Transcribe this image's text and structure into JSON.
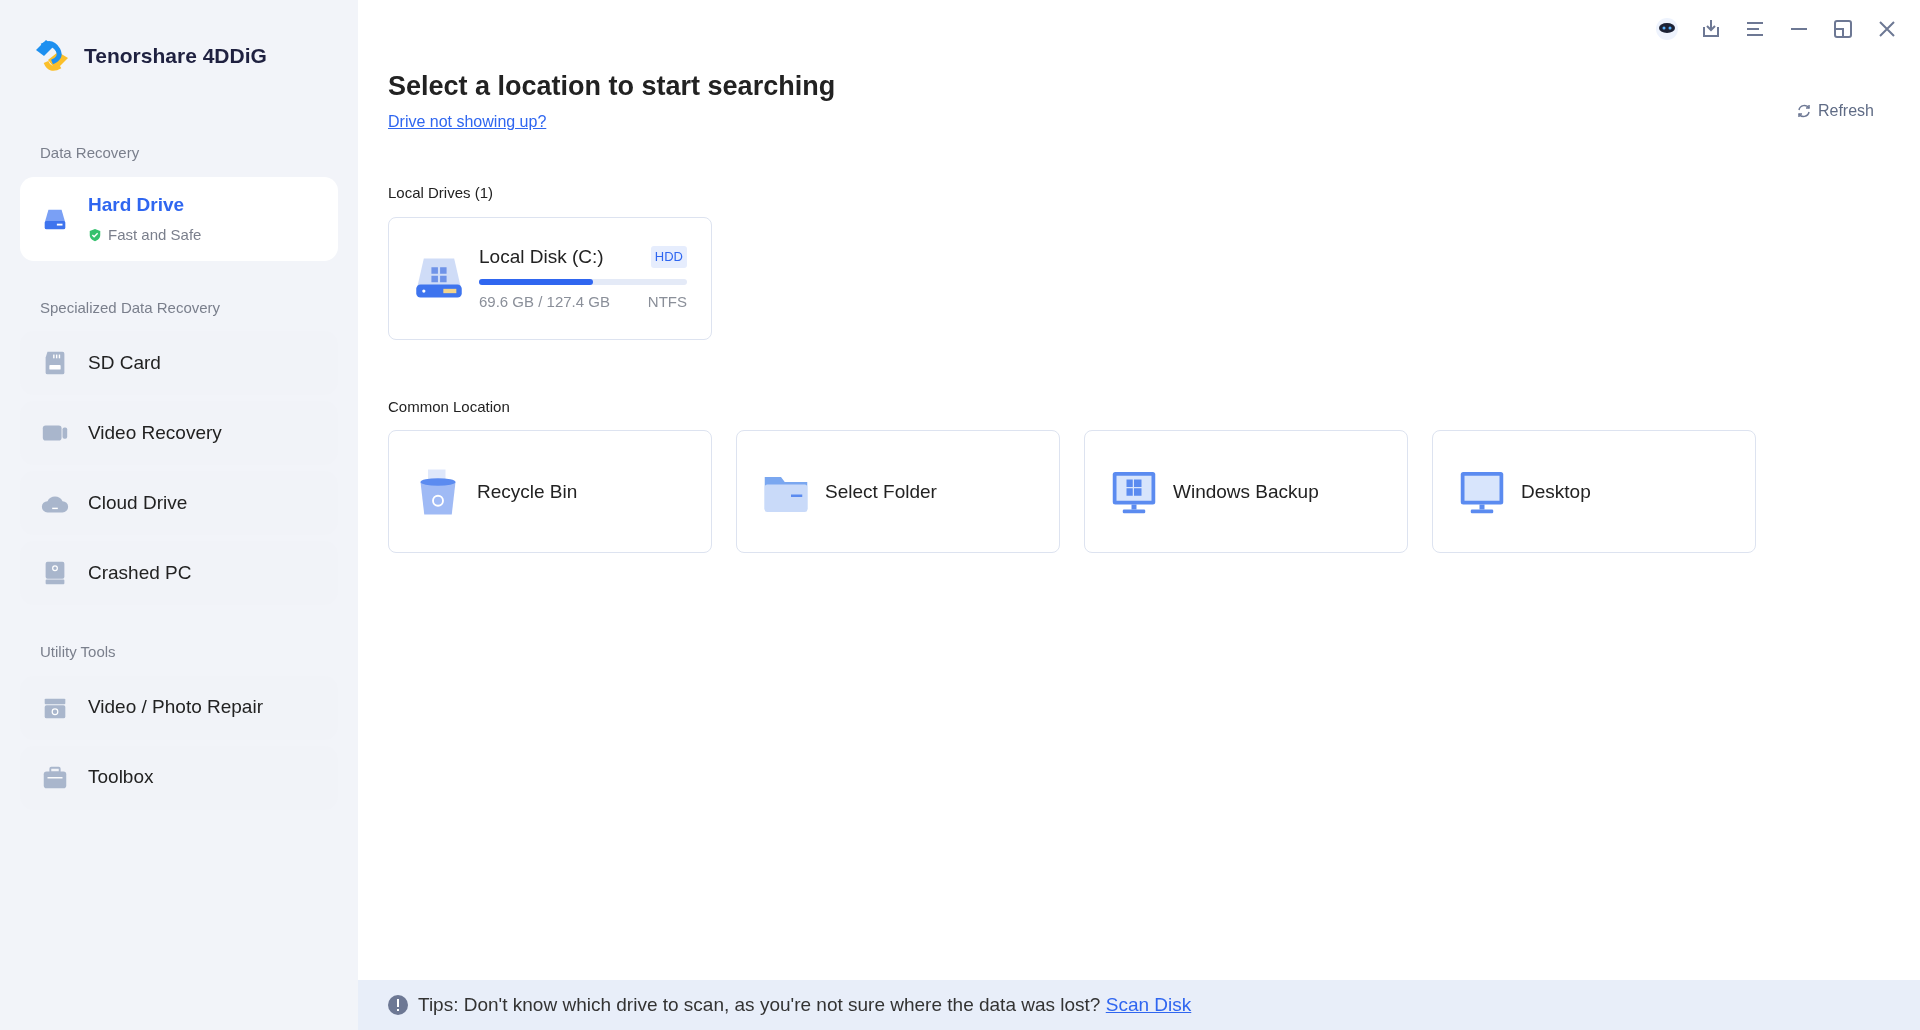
{
  "app": {
    "name": "Tenorshare 4DDiG"
  },
  "sidebar": {
    "sections": [
      {
        "title": "Data Recovery",
        "items": [
          {
            "kind": "hard-drive",
            "label": "Hard Drive",
            "subtitle": "Fast and Safe",
            "selected": true
          }
        ]
      },
      {
        "title": "Specialized Data Recovery",
        "items": [
          {
            "kind": "sd-card",
            "label": "SD Card",
            "selected": false
          },
          {
            "kind": "video",
            "label": "Video Recovery",
            "selected": false
          },
          {
            "kind": "cloud",
            "label": "Cloud Drive",
            "selected": false
          },
          {
            "kind": "crashed",
            "label": "Crashed PC",
            "selected": false
          }
        ]
      },
      {
        "title": "Utility Tools",
        "items": [
          {
            "kind": "repair",
            "label": "Video / Photo Repair",
            "selected": false
          },
          {
            "kind": "toolbox",
            "label": "Toolbox",
            "selected": false
          }
        ]
      }
    ]
  },
  "main": {
    "title": "Select a location to start searching",
    "help_link": "Drive not showing up?",
    "refresh": "Refresh",
    "local_drives": {
      "heading": "Local Drives (1)",
      "drives": [
        {
          "name": "Local Disk (C:)",
          "type": "HDD",
          "level": 0.546,
          "usage": "69.6 GB / 127.4 GB",
          "filesystem": "NTFS"
        }
      ]
    },
    "common_location": {
      "heading": "Common Location",
      "items": [
        {
          "kind": "recycle-bin",
          "label": "Recycle Bin"
        },
        {
          "kind": "folder",
          "label": "Select Folder"
        },
        {
          "kind": "windows-backup",
          "label": "Windows Backup"
        },
        {
          "kind": "desktop",
          "label": "Desktop"
        }
      ]
    }
  },
  "tip_bar": {
    "text": "Tips: Don't know which drive to scan, as you're not sure where the data was lost?",
    "link": "Scan Disk"
  }
}
